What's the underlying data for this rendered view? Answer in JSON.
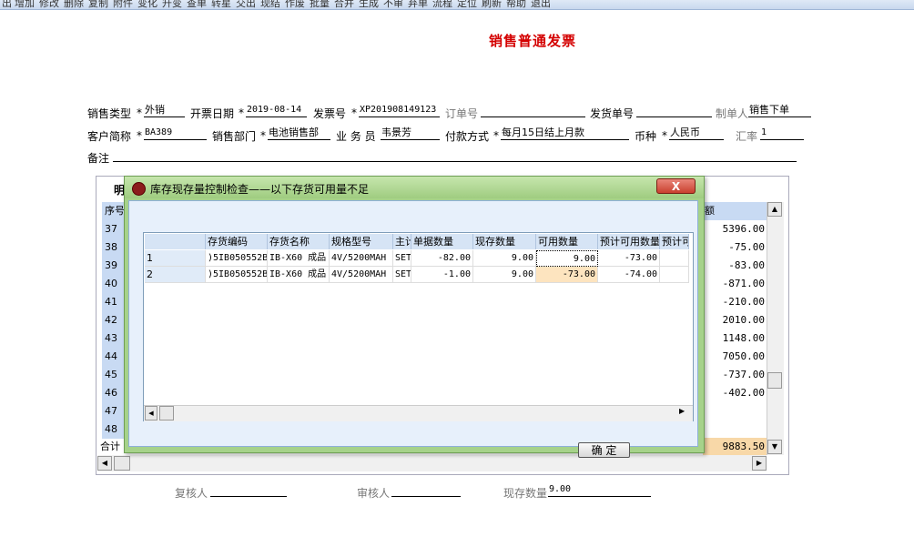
{
  "toolbar": {
    "items": [
      "出",
      "增加",
      "修改",
      "删除",
      "复制",
      "附件",
      "变化",
      "升变",
      "查单",
      "转星",
      "交出",
      "现结",
      "作废",
      "批量",
      "合并",
      "生成",
      "不审",
      "弃单",
      "流程",
      "定位",
      "刷新",
      "帮助",
      "退出"
    ]
  },
  "invoice": {
    "title": "销售普通发票",
    "fields": {
      "sale_type_label": "销售类型",
      "sale_type": "外销",
      "invoice_date_label": "开票日期",
      "invoice_date": "2019-08-14",
      "invoice_no_label": "发票号",
      "invoice_no": "XP201908149123",
      "order_no_label": "订单号",
      "order_no": "",
      "delivery_no_label": "发货单号",
      "delivery_no": "",
      "maker_label": "制单人",
      "maker": "销售下单",
      "customer_label": "客户简称",
      "customer": "BA389",
      "dept_label": "销售部门",
      "dept": "电池销售部",
      "salesman_label": "业 务 员",
      "salesman": "韦景芳",
      "payment_label": "付款方式",
      "payment": "每月15日结上月款",
      "currency_label": "币种",
      "currency": "人民币",
      "rate_label": "汇率",
      "rate": "1",
      "remark_label": "备注",
      "remark": ""
    }
  },
  "grid": {
    "tab_label": "明",
    "header_seq": "序号",
    "header_amount": "额",
    "rows": [
      {
        "seq": "37",
        "amount": "5396.00"
      },
      {
        "seq": "38",
        "amount": "-75.00"
      },
      {
        "seq": "39",
        "amount": "-83.00"
      },
      {
        "seq": "40",
        "amount": "-871.00"
      },
      {
        "seq": "41",
        "amount": "-210.00"
      },
      {
        "seq": "42",
        "amount": "2010.00"
      },
      {
        "seq": "43",
        "amount": "1148.00"
      },
      {
        "seq": "44",
        "amount": "7050.00"
      },
      {
        "seq": "45",
        "amount": "-737.00"
      },
      {
        "seq": "46",
        "amount": "-402.00"
      },
      {
        "seq": "47",
        "amount": ""
      },
      {
        "seq": "48",
        "amount": ""
      }
    ],
    "total_label": "合计",
    "total_amount": "9883.50"
  },
  "footer": {
    "reviewer_label": "复核人",
    "reviewer": "",
    "auditor_label": "审核人",
    "auditor": "",
    "stock_qty_label": "现存数量",
    "stock_qty": "9.00"
  },
  "dialog": {
    "title": "库存现存量控制检查——以下存货可用量不足",
    "close_label": "X",
    "ok_label": "确 定",
    "columns": [
      "",
      "存货编码",
      "存货名称",
      "规格型号",
      "主计",
      "单据数量",
      "现存数量",
      "可用数量",
      "预计可用数量",
      "预计可"
    ],
    "rows": [
      [
        "1",
        ")5IB050552B",
        "IB-X60 成品",
        "4V/5200MAH",
        "SET",
        "-82.00",
        "9.00",
        "9.00",
        "-73.00",
        ""
      ],
      [
        "2",
        ")5IB050552B",
        "IB-X60 成品",
        "4V/5200MAH",
        "SET",
        "-1.00",
        "9.00",
        "-73.00",
        "-74.00",
        ""
      ]
    ]
  }
}
